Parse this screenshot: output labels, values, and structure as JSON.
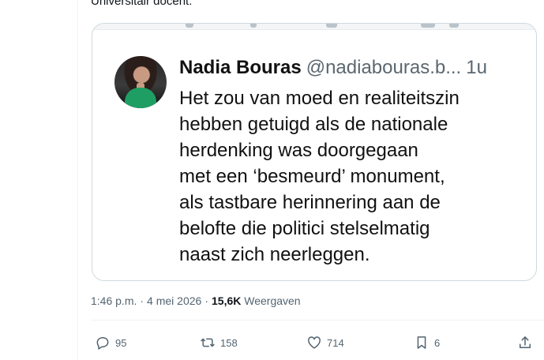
{
  "tweet": {
    "top_text": "Universitair docent:",
    "embed": {
      "name": "Nadia Bouras",
      "handle": "@nadiabouras.b...",
      "time": "1u",
      "lines": [
        "Het zou van moed en realiteitszin",
        "hebben getuigd als de nationale",
        "herdenking was doorgegaan",
        "met een ‘besmeurd’ monument,",
        "als tastbare herinnering aan de",
        "belofte die politici stelselmatig",
        "naast zich neerleggen."
      ]
    },
    "meta": {
      "timestamp": "1:46 p.m.",
      "separator": "·",
      "date": "4 mei 2026",
      "views_count": "15,6K",
      "views_label": "Weergaven"
    },
    "actions": {
      "reply_count": "95",
      "repost_count": "158",
      "like_count": "714",
      "bookmark_count": "6"
    }
  },
  "icons": {
    "reply": "reply-icon",
    "repost": "repost-icon",
    "like": "heart-icon",
    "bookmark": "bookmark-icon",
    "share": "share-icon"
  },
  "colors": {
    "text_primary": "#0f1419",
    "text_secondary": "#536471",
    "border": "#cfd9de",
    "avatar_accent": "#1f9e64"
  }
}
